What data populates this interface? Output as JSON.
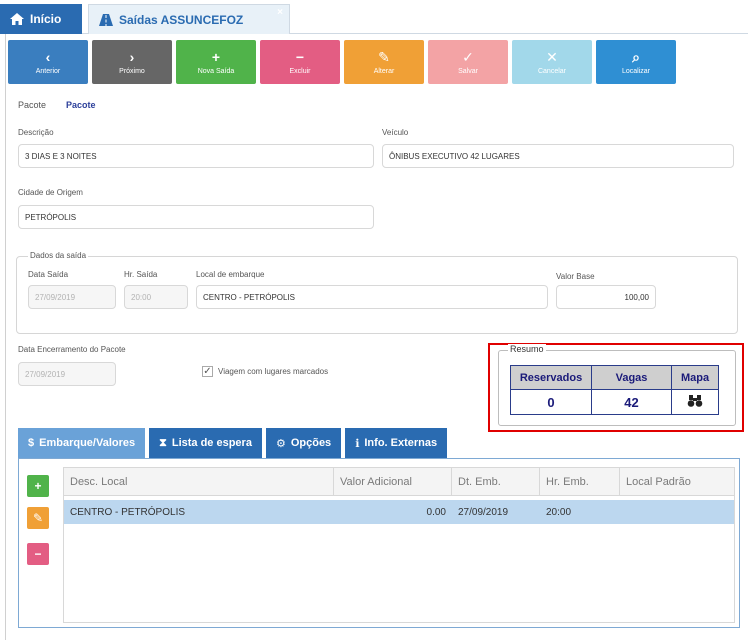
{
  "tabs": {
    "home": "Início",
    "active": "Saídas ASSUNCEFOZ",
    "close": "×"
  },
  "toolbar": [
    {
      "glyph": "‹",
      "label": "Anterior",
      "color": "#3a7ebf"
    },
    {
      "glyph": "›",
      "label": "Próximo",
      "color": "#666666"
    },
    {
      "glyph": "+",
      "label": "Nova Saída",
      "color": "#50b34a"
    },
    {
      "glyph": "−",
      "label": "Excluir",
      "color": "#e35d83"
    },
    {
      "glyph": "✎",
      "label": "Alterar",
      "color": "#f0a036"
    },
    {
      "glyph": "✓",
      "label": "Salvar",
      "color": "#f3a3a5"
    },
    {
      "glyph": "✕",
      "label": "Cancelar",
      "color": "#a2d8ea"
    },
    {
      "glyph": "⌕",
      "label": "Localizar",
      "color": "#2f8fd3"
    }
  ],
  "form": {
    "pacote_label": "Pacote",
    "pacote_value": "Pacote",
    "descricao_label": "Descrição",
    "descricao_value": "3 DIAS E 3 NOITES",
    "veiculo_label": "Veículo",
    "veiculo_value": "ÔNIBUS EXECUTIVO 42 LUGARES",
    "cidade_label": "Cidade de Origem",
    "cidade_value": "PETRÓPOLIS",
    "dados_legend": "Dados da saída",
    "data_saida_label": "Data Saída",
    "data_saida_value": "27/09/2019",
    "hr_saida_label": "Hr. Saída",
    "hr_saida_value": "20:00",
    "local_label": "Local de embarque",
    "local_value": "CENTRO - PETRÓPOLIS",
    "valor_label": "Valor Base",
    "valor_value": "100,00",
    "encerramento_label": "Data Encerramento do Pacote",
    "encerramento_value": "27/09/2019",
    "viagem_label": "Viagem com lugares marcados",
    "viagem_checked": "✓"
  },
  "resumo": {
    "legend": "Resumo",
    "headers": [
      "Reservados",
      "Vagas",
      "Mapa"
    ],
    "reservados": "0",
    "vagas": "42"
  },
  "bottom_tabs": [
    {
      "icon": "$",
      "label": "Embarque/Valores"
    },
    {
      "icon": "⧗",
      "label": "Lista de espera"
    },
    {
      "icon": "⚙",
      "label": "Opções"
    },
    {
      "icon": "ℹ",
      "label": "Info. Externas"
    }
  ],
  "grid": {
    "columns": [
      "Desc. Local",
      "Valor Adicional",
      "Dt. Emb.",
      "Hr. Emb.",
      "Local Padrão"
    ],
    "rows": [
      [
        "CENTRO - PETRÓPOLIS",
        "0.00",
        "27/09/2019",
        "20:00",
        ""
      ]
    ]
  },
  "side_buttons": [
    {
      "glyph": "+",
      "color": "#50b34a"
    },
    {
      "glyph": "✎",
      "color": "#f0a036"
    },
    {
      "glyph": "−",
      "color": "#e35d83"
    }
  ]
}
